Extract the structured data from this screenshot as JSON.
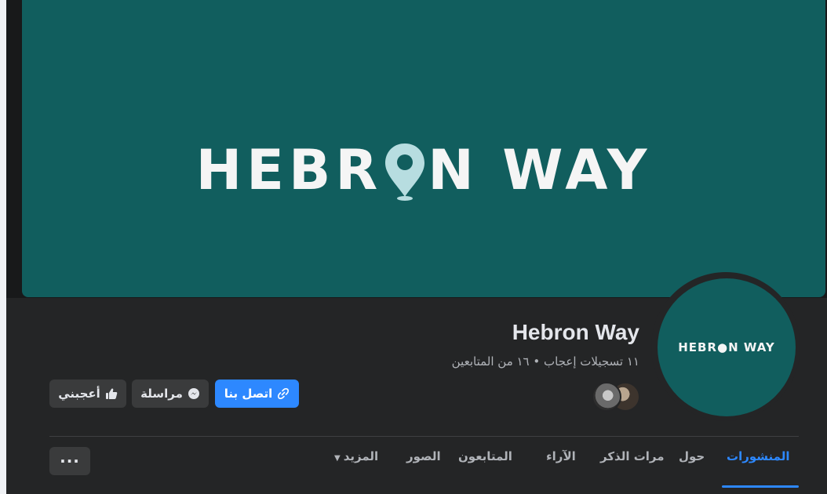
{
  "cover": {
    "logo_text_left": "HEBR",
    "logo_text_right": "N WAY",
    "background_color": "#115e5e"
  },
  "avatar": {
    "logo_text": "HEBR●N WAY"
  },
  "page": {
    "name": "Hebron Way",
    "stats": "١١ تسجيلات إعجاب • ١٦ من المتابعين"
  },
  "actions": {
    "contact": "اتصل بنا",
    "message": "مراسلة",
    "like": "أعجبني",
    "more": "···"
  },
  "tabs": [
    {
      "label": "المنشورات",
      "active": true
    },
    {
      "label": "حول"
    },
    {
      "label": "مرات الذكر"
    },
    {
      "label": "الآراء"
    },
    {
      "label": "المتابعون"
    },
    {
      "label": "الصور"
    },
    {
      "label": "المزيد"
    }
  ],
  "colors": {
    "accent": "#2d88ff",
    "surface": "#242526",
    "button": "#3a3b3c"
  },
  "icons": {
    "contact": "link-icon",
    "message": "messenger-icon",
    "like": "thumbs-up-icon",
    "more": "caret-down-icon"
  }
}
